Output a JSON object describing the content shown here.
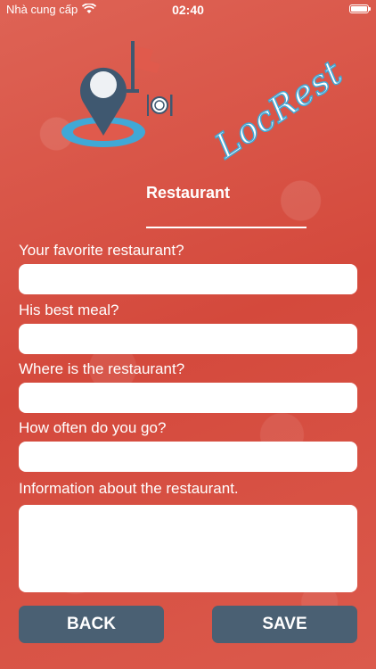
{
  "status_bar": {
    "carrier": "Nhà cung cấp",
    "time": "02:40",
    "wifi_icon": "wifi-icon",
    "battery_icon": "battery-icon"
  },
  "logo": {
    "text": "LocRest",
    "pin_color": "#3f5870",
    "ring_color": "#41a8d6",
    "flag_color": "#e05a4c"
  },
  "page_title": "Restaurant",
  "form": {
    "favorite_label": "Your favorite restaurant?",
    "favorite_value": "",
    "meal_label": "His best meal?",
    "meal_value": "",
    "location_label": "Where is the restaurant?",
    "location_value": "",
    "frequency_label": "How often do you go?",
    "frequency_value": "",
    "info_label": "Information about the restaurant.",
    "info_value": ""
  },
  "buttons": {
    "back_label": "BACK",
    "save_label": "SAVE"
  },
  "colors": {
    "background": "#d9574a",
    "button": "#4a6073"
  }
}
